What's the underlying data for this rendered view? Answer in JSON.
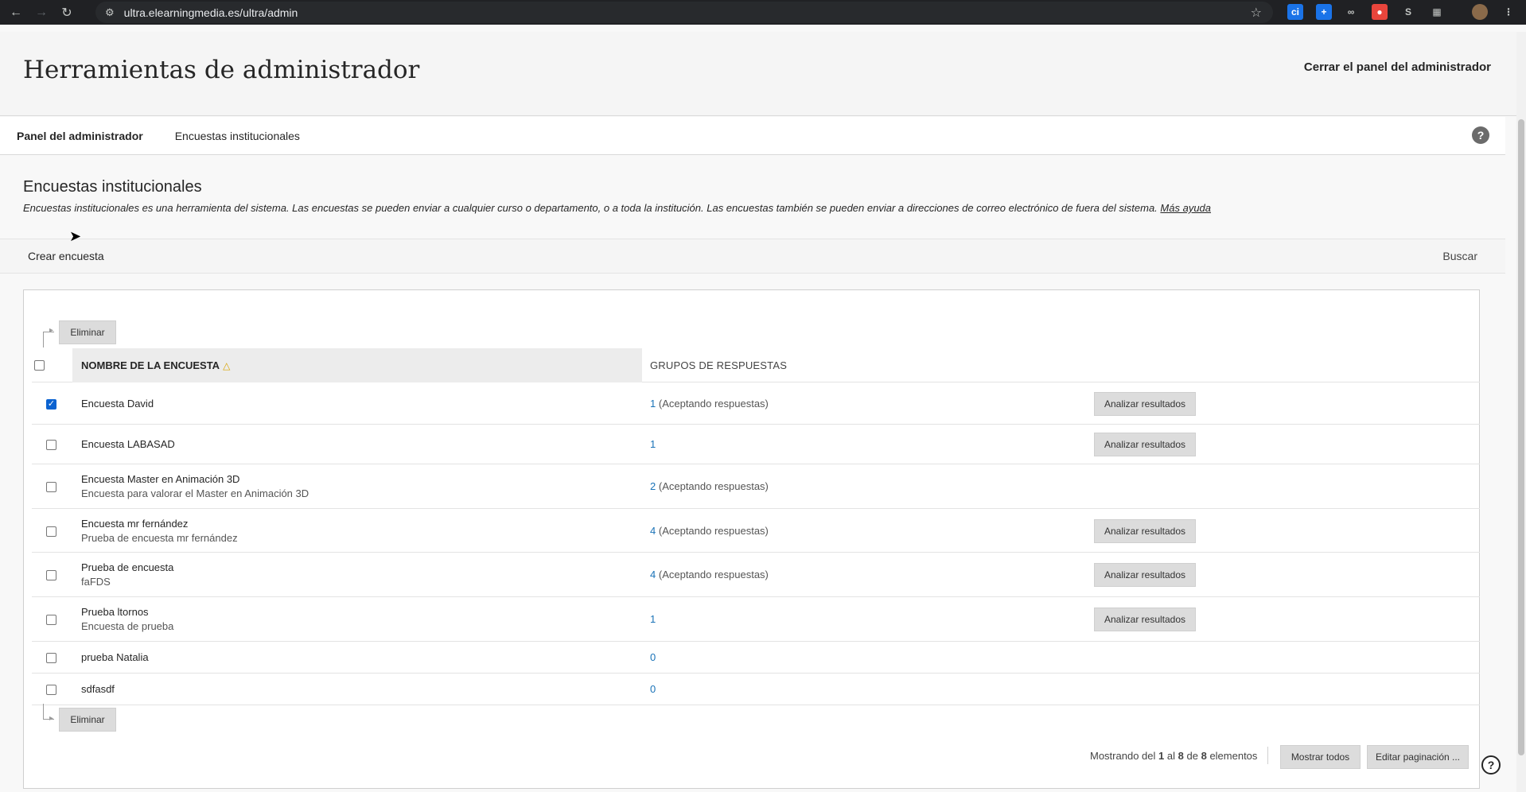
{
  "browser": {
    "url": "ultra.elearningmedia.es/ultra/admin"
  },
  "header": {
    "title": "Herramientas de administrador",
    "close_label": "Cerrar el panel del administrador"
  },
  "breadcrumb": {
    "items": [
      "Panel del administrador",
      "Encuestas institucionales"
    ],
    "help": "?"
  },
  "section": {
    "title": "Encuestas institucionales",
    "description": "Encuestas institucionales es una herramienta del sistema. Las encuestas se pueden enviar a cualquier curso o departamento, o a toda la institución. Las encuestas también se pueden enviar a direcciones de correo electrónico de fuera del sistema.",
    "more_help": "Más ayuda"
  },
  "actions": {
    "create": "Crear encuesta",
    "search": "Buscar"
  },
  "table": {
    "delete_label": "Eliminar",
    "col_name": "NOMBRE DE LA ENCUESTA",
    "col_groups": "GRUPOS DE RESPUESTAS",
    "analyze_label": "Analizar resultados",
    "rows": [
      {
        "name": "Encuesta David",
        "desc": "",
        "groups_num": "1",
        "groups_text": "(Aceptando respuestas)",
        "checked": true,
        "analyze": true
      },
      {
        "name": "Encuesta LABASAD",
        "desc": "",
        "groups_num": "1",
        "groups_text": "",
        "checked": false,
        "analyze": true
      },
      {
        "name": "Encuesta Master en Animación 3D",
        "desc": "Encuesta para valorar el Master en Animación 3D",
        "groups_num": "2",
        "groups_text": "(Aceptando respuestas)",
        "checked": false,
        "analyze": false
      },
      {
        "name": "Encuesta mr fernández",
        "desc": "Prueba de encuesta mr fernández",
        "groups_num": "4",
        "groups_text": "(Aceptando respuestas)",
        "checked": false,
        "analyze": true
      },
      {
        "name": "Prueba de encuesta",
        "desc": "faFDS",
        "groups_num": "4",
        "groups_text": "(Aceptando respuestas)",
        "checked": false,
        "analyze": true
      },
      {
        "name": "Prueba ltornos",
        "desc": "Encuesta de prueba",
        "groups_num": "1",
        "groups_text": "",
        "checked": false,
        "analyze": true
      },
      {
        "name": "prueba Natalia",
        "desc": "",
        "groups_num": "0",
        "groups_text": "",
        "checked": false,
        "analyze": false
      },
      {
        "name": "sdfasdf",
        "desc": "",
        "groups_num": "0",
        "groups_text": "",
        "checked": false,
        "analyze": false
      }
    ]
  },
  "pagination": {
    "prefix": "Mostrando del",
    "from": "1",
    "mid1": "al",
    "to": "8",
    "mid2": "de",
    "total": "8",
    "suffix": "elementos",
    "show_all": "Mostrar todos",
    "edit_paging": "Editar paginación ..."
  },
  "colors": {
    "link_blue": "#1a73b8",
    "check_blue": "#0b63d1",
    "sort_indicator": "#d9a400"
  }
}
